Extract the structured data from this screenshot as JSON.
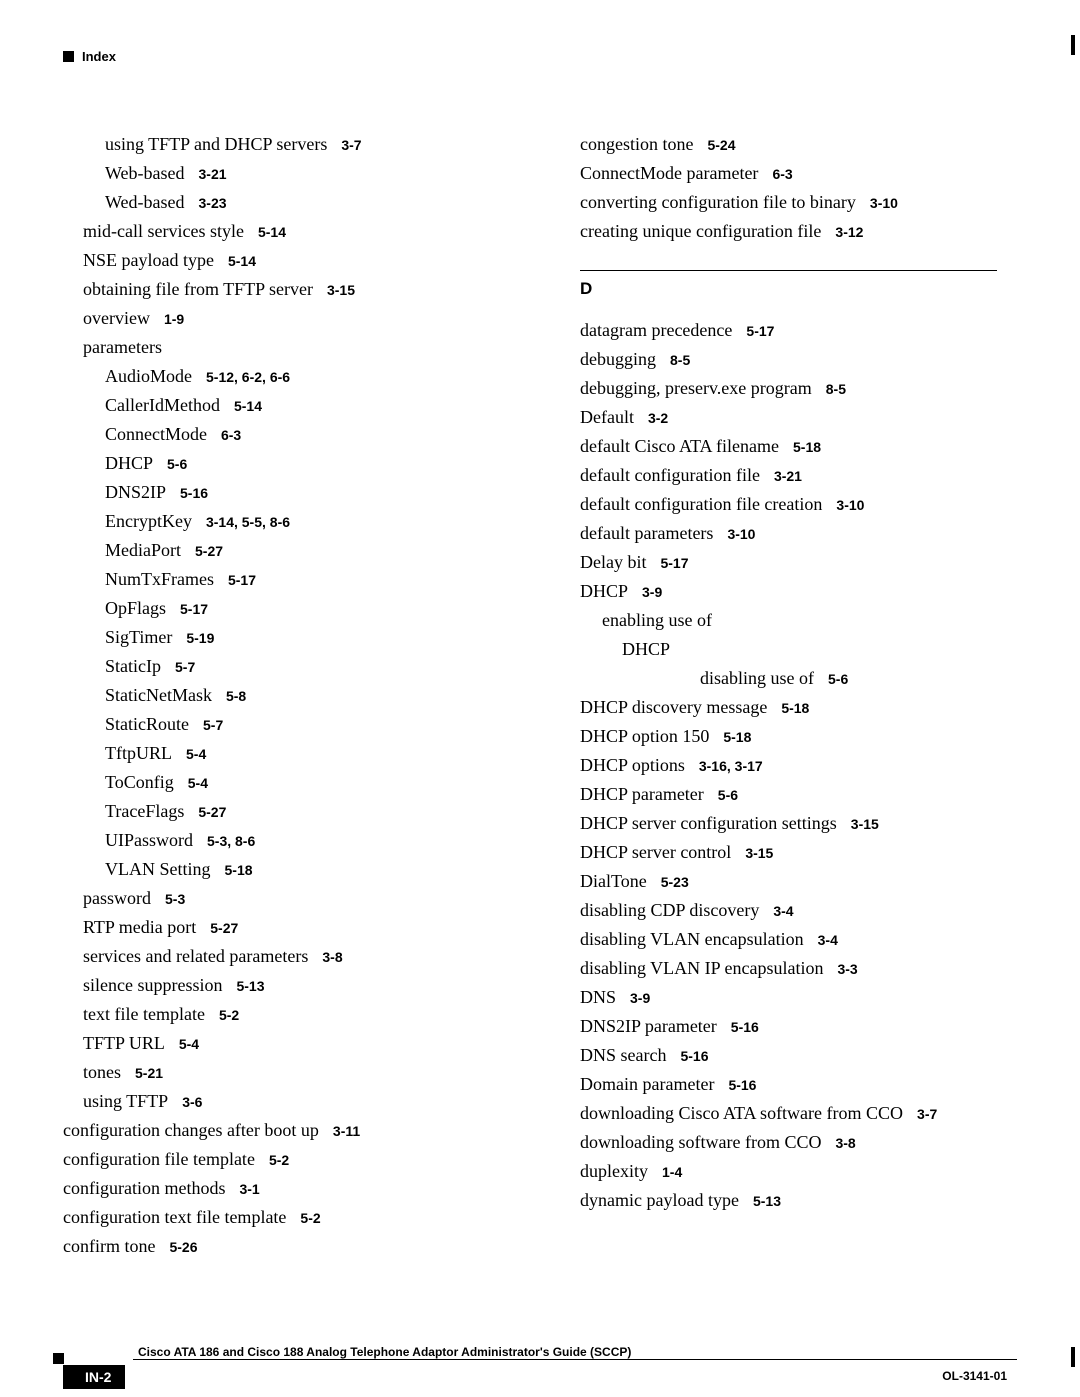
{
  "header": "Index",
  "section_d": {
    "label": "D"
  },
  "left": [
    {
      "t": "using TFTP and DHCP servers",
      "p": "3-7",
      "i": 1
    },
    {
      "t": "Web-based",
      "p": "3-21",
      "i": 1
    },
    {
      "t": "Wed-based",
      "p": "3-23",
      "i": 1
    },
    {
      "t": "mid-call services style",
      "p": "5-14",
      "i": 0
    },
    {
      "t": "NSE payload type",
      "p": "5-14",
      "i": 0
    },
    {
      "t": "obtaining file from TFTP server",
      "p": "3-15",
      "i": 0
    },
    {
      "t": "overview",
      "p": "1-9",
      "i": 0
    },
    {
      "t": "parameters",
      "p": "",
      "i": 0
    },
    {
      "t": "AudioMode",
      "p": "5-12, 6-2, 6-6",
      "i": 1
    },
    {
      "t": "CallerIdMethod",
      "p": "5-14",
      "i": 1
    },
    {
      "t": "ConnectMode",
      "p": "6-3",
      "i": 1
    },
    {
      "t": "DHCP",
      "p": "5-6",
      "i": 1
    },
    {
      "t": "DNS2IP",
      "p": "5-16",
      "i": 1
    },
    {
      "t": "EncryptKey",
      "p": "3-14, 5-5, 8-6",
      "i": 1
    },
    {
      "t": "MediaPort",
      "p": "5-27",
      "i": 1
    },
    {
      "t": "NumTxFrames",
      "p": "5-17",
      "i": 1
    },
    {
      "t": "OpFlags",
      "p": "5-17",
      "i": 1
    },
    {
      "t": "SigTimer",
      "p": "5-19",
      "i": 1
    },
    {
      "t": "StaticIp",
      "p": "5-7",
      "i": 1
    },
    {
      "t": "StaticNetMask",
      "p": "5-8",
      "i": 1
    },
    {
      "t": "StaticRoute",
      "p": "5-7",
      "i": 1
    },
    {
      "t": "TftpURL",
      "p": "5-4",
      "i": 1
    },
    {
      "t": "ToConfig",
      "p": "5-4",
      "i": 1
    },
    {
      "t": "TraceFlags",
      "p": "5-27",
      "i": 1
    },
    {
      "t": "UIPassword",
      "p": "5-3, 8-6",
      "i": 1
    },
    {
      "t": "VLAN Setting",
      "p": "5-18",
      "i": 1
    },
    {
      "t": "password",
      "p": "5-3",
      "i": 0
    },
    {
      "t": "RTP media port",
      "p": "5-27",
      "i": 0
    },
    {
      "t": "services and related parameters",
      "p": "3-8",
      "i": 0
    },
    {
      "t": "silence suppression",
      "p": "5-13",
      "i": 0
    },
    {
      "t": "text file template",
      "p": "5-2",
      "i": 0
    },
    {
      "t": "TFTP URL",
      "p": "5-4",
      "i": 0
    },
    {
      "t": "tones",
      "p": "5-21",
      "i": 0
    },
    {
      "t": "using TFTP",
      "p": "3-6",
      "i": 0
    },
    {
      "t": "configuration changes after boot up",
      "p": "3-11",
      "i": -1
    },
    {
      "t": "configuration file template",
      "p": "5-2",
      "i": -1
    },
    {
      "t": "configuration methods",
      "p": "3-1",
      "i": -1
    },
    {
      "t": "configuration text file template",
      "p": "5-2",
      "i": -1
    },
    {
      "t": "confirm tone",
      "p": "5-26",
      "i": -1
    }
  ],
  "right_top": [
    {
      "t": "congestion tone",
      "p": "5-24",
      "i": 0
    },
    {
      "t": "ConnectMode parameter",
      "p": "6-3",
      "i": 0
    },
    {
      "t": "converting configuration file to binary",
      "p": "3-10",
      "i": 0
    },
    {
      "t": "creating unique configuration file",
      "p": "3-12",
      "i": 0
    }
  ],
  "right_d": [
    {
      "t": "datagram precedence",
      "p": "5-17",
      "i": 0
    },
    {
      "t": "debugging",
      "p": "8-5",
      "i": 0
    },
    {
      "t": "debugging, preserv.exe program",
      "p": "8-5",
      "i": 0
    },
    {
      "t": "Default",
      "p": "3-2",
      "i": 0
    },
    {
      "t": "default Cisco ATA filename",
      "p": "5-18",
      "i": 0
    },
    {
      "t": "default configuration file",
      "p": "3-21",
      "i": 0
    },
    {
      "t": "default configuration file creation",
      "p": "3-10",
      "i": 0
    },
    {
      "t": "default parameters",
      "p": "3-10",
      "i": 0
    },
    {
      "t": "Delay bit",
      "p": "5-17",
      "i": 0
    },
    {
      "t": "DHCP",
      "p": "3-9",
      "i": 0
    },
    {
      "t": "enabling use of",
      "p": "",
      "i": 1
    },
    {
      "t": "DHCP",
      "p": "",
      "i": 2
    },
    {
      "t": "disabling use of",
      "p": "5-6",
      "i": 4
    },
    {
      "t": "DHCP discovery message",
      "p": "5-18",
      "i": 0
    },
    {
      "t": "DHCP option 150",
      "p": "5-18",
      "i": 0
    },
    {
      "t": "DHCP options",
      "p": "3-16, 3-17",
      "i": 0
    },
    {
      "t": "DHCP parameter",
      "p": "5-6",
      "i": 0
    },
    {
      "t": "DHCP server configuration settings",
      "p": "3-15",
      "i": 0
    },
    {
      "t": "DHCP server control",
      "p": "3-15",
      "i": 0
    },
    {
      "t": "DialTone",
      "p": "5-23",
      "i": 0
    },
    {
      "t": "disabling CDP discovery",
      "p": "3-4",
      "i": 0
    },
    {
      "t": "disabling VLAN encapsulation",
      "p": "3-4",
      "i": 0
    },
    {
      "t": "disabling VLAN IP encapsulation",
      "p": "3-3",
      "i": 0
    },
    {
      "t": "DNS",
      "p": "3-9",
      "i": 0
    },
    {
      "t": "DNS2IP parameter",
      "p": "5-16",
      "i": 0
    },
    {
      "t": "DNS search",
      "p": "5-16",
      "i": 0
    },
    {
      "t": "Domain parameter",
      "p": "5-16",
      "i": 0
    },
    {
      "t": "downloading Cisco ATA software from CCO",
      "p": "3-7",
      "i": 0
    },
    {
      "t": "downloading software from CCO",
      "p": "3-8",
      "i": 0
    },
    {
      "t": "duplexity",
      "p": "1-4",
      "i": 0
    },
    {
      "t": "dynamic payload type",
      "p": "5-13",
      "i": 0
    }
  ],
  "footer": {
    "title": "Cisco ATA 186 and Cisco 188 Analog Telephone Adaptor Administrator's Guide (SCCP)",
    "page": "IN-2",
    "docid": "OL-3141-01"
  }
}
